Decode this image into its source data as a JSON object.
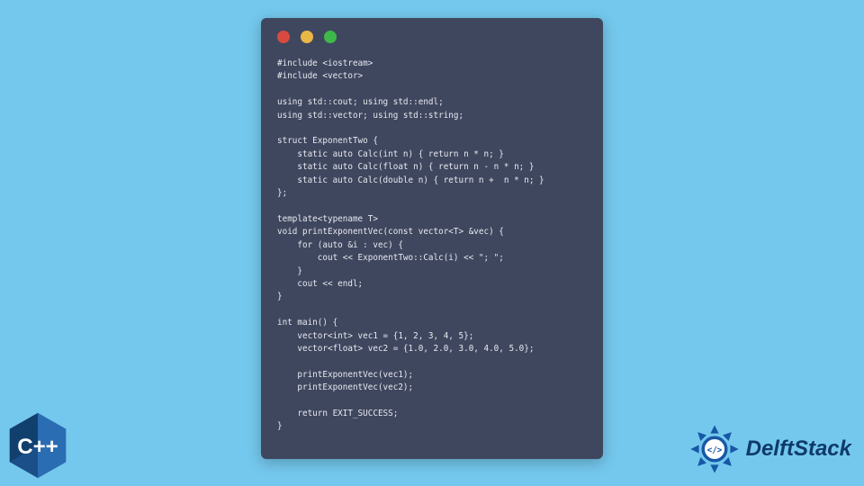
{
  "window": {
    "dots": [
      "red",
      "yellow",
      "green"
    ]
  },
  "code_lines": [
    "#include <iostream>",
    "#include <vector>",
    "",
    "using std::cout; using std::endl;",
    "using std::vector; using std::string;",
    "",
    "struct ExponentTwo {",
    "    static auto Calc(int n) { return n * n; }",
    "    static auto Calc(float n) { return n - n * n; }",
    "    static auto Calc(double n) { return n +  n * n; }",
    "};",
    "",
    "template<typename T>",
    "void printExponentVec(const vector<T> &vec) {",
    "    for (auto &i : vec) {",
    "        cout << ExponentTwo::Calc(i) << \"; \";",
    "    }",
    "    cout << endl;",
    "}",
    "",
    "int main() {",
    "    vector<int> vec1 = {1, 2, 3, 4, 5};",
    "    vector<float> vec2 = {1.0, 2.0, 3.0, 4.0, 5.0};",
    "",
    "    printExponentVec(vec1);",
    "    printExponentVec(vec2);",
    "",
    "    return EXIT_SUCCESS;",
    "}"
  ],
  "cpp_badge": {
    "label": "C++"
  },
  "brand": {
    "name": "DelftStack"
  }
}
